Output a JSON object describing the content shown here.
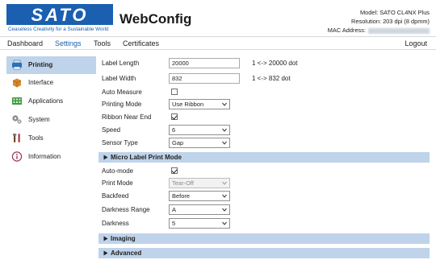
{
  "header": {
    "brand_tagline": "Ceaseless Creativity for a Sustainable World",
    "app_title": "WebConfig",
    "model_label": "Model: SATO CL4NX Plus",
    "resolution_label": "Resolution: 203 dpi (8 dpmm)",
    "mac_label": "MAC Address:",
    "brand_color": "#1a5fb0"
  },
  "nav": {
    "dashboard": "Dashboard",
    "settings": "Settings",
    "tools": "Tools",
    "certificates": "Certificates",
    "logout": "Logout",
    "active": "Settings"
  },
  "sidebar": {
    "items": [
      {
        "label": "Printing",
        "icon": "printer-icon",
        "active": true
      },
      {
        "label": "Interface",
        "icon": "network-icon",
        "active": false
      },
      {
        "label": "Applications",
        "icon": "applications-icon",
        "active": false
      },
      {
        "label": "System",
        "icon": "gears-icon",
        "active": false
      },
      {
        "label": "Tools",
        "icon": "tools-icon",
        "active": false
      },
      {
        "label": "Information",
        "icon": "info-icon",
        "active": false
      }
    ]
  },
  "form": {
    "label_length": {
      "label": "Label Length",
      "value": "20000",
      "range": "1 <-> 20000 dot"
    },
    "label_width": {
      "label": "Label Width",
      "value": "832",
      "range": "1 <-> 832 dot"
    },
    "auto_measure": {
      "label": "Auto Measure",
      "checked": false
    },
    "printing_mode": {
      "label": "Printing Mode",
      "value": "Use Ribbon"
    },
    "ribbon_near_end": {
      "label": "Ribbon Near End",
      "checked": true
    },
    "speed": {
      "label": "Speed",
      "value": "6"
    },
    "sensor_type": {
      "label": "Sensor Type",
      "value": "Gap"
    },
    "micro_section": {
      "title": "Micro Label Print Mode"
    },
    "auto_mode": {
      "label": "Auto-mode",
      "checked": true
    },
    "print_mode": {
      "label": "Print Mode",
      "value": "Tear-Off",
      "disabled": true
    },
    "backfeed": {
      "label": "Backfeed",
      "value": "Before"
    },
    "darkness_range": {
      "label": "Darkness Range",
      "value": "A"
    },
    "darkness": {
      "label": "Darkness",
      "value": "5"
    },
    "imaging_section": {
      "title": "Imaging"
    },
    "advanced_section": {
      "title": "Advanced"
    }
  },
  "colors": {
    "section_bar": "#bfd3ea",
    "active_nav": "#1a5fb0"
  }
}
